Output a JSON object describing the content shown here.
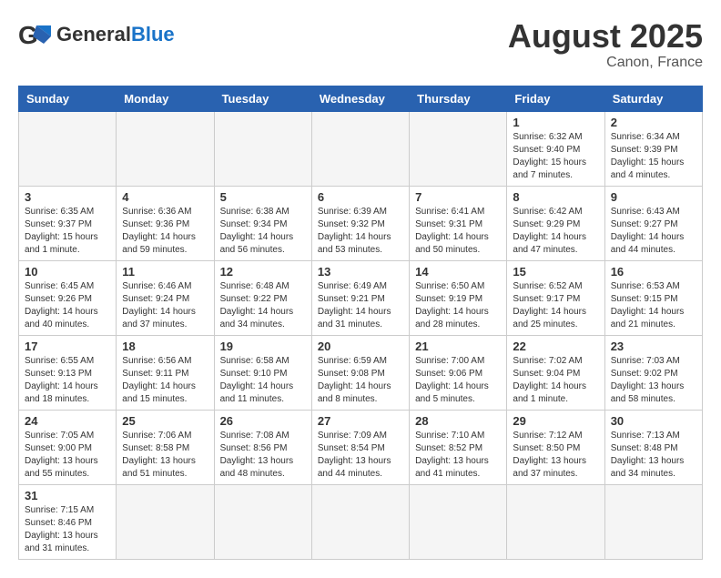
{
  "header": {
    "logo_general": "General",
    "logo_blue": "Blue",
    "month_title": "August 2025",
    "location": "Canon, France"
  },
  "days_of_week": [
    "Sunday",
    "Monday",
    "Tuesday",
    "Wednesday",
    "Thursday",
    "Friday",
    "Saturday"
  ],
  "weeks": [
    [
      {
        "day": "",
        "info": ""
      },
      {
        "day": "",
        "info": ""
      },
      {
        "day": "",
        "info": ""
      },
      {
        "day": "",
        "info": ""
      },
      {
        "day": "",
        "info": ""
      },
      {
        "day": "1",
        "info": "Sunrise: 6:32 AM\nSunset: 9:40 PM\nDaylight: 15 hours and 7 minutes."
      },
      {
        "day": "2",
        "info": "Sunrise: 6:34 AM\nSunset: 9:39 PM\nDaylight: 15 hours and 4 minutes."
      }
    ],
    [
      {
        "day": "3",
        "info": "Sunrise: 6:35 AM\nSunset: 9:37 PM\nDaylight: 15 hours and 1 minute."
      },
      {
        "day": "4",
        "info": "Sunrise: 6:36 AM\nSunset: 9:36 PM\nDaylight: 14 hours and 59 minutes."
      },
      {
        "day": "5",
        "info": "Sunrise: 6:38 AM\nSunset: 9:34 PM\nDaylight: 14 hours and 56 minutes."
      },
      {
        "day": "6",
        "info": "Sunrise: 6:39 AM\nSunset: 9:32 PM\nDaylight: 14 hours and 53 minutes."
      },
      {
        "day": "7",
        "info": "Sunrise: 6:41 AM\nSunset: 9:31 PM\nDaylight: 14 hours and 50 minutes."
      },
      {
        "day": "8",
        "info": "Sunrise: 6:42 AM\nSunset: 9:29 PM\nDaylight: 14 hours and 47 minutes."
      },
      {
        "day": "9",
        "info": "Sunrise: 6:43 AM\nSunset: 9:27 PM\nDaylight: 14 hours and 44 minutes."
      }
    ],
    [
      {
        "day": "10",
        "info": "Sunrise: 6:45 AM\nSunset: 9:26 PM\nDaylight: 14 hours and 40 minutes."
      },
      {
        "day": "11",
        "info": "Sunrise: 6:46 AM\nSunset: 9:24 PM\nDaylight: 14 hours and 37 minutes."
      },
      {
        "day": "12",
        "info": "Sunrise: 6:48 AM\nSunset: 9:22 PM\nDaylight: 14 hours and 34 minutes."
      },
      {
        "day": "13",
        "info": "Sunrise: 6:49 AM\nSunset: 9:21 PM\nDaylight: 14 hours and 31 minutes."
      },
      {
        "day": "14",
        "info": "Sunrise: 6:50 AM\nSunset: 9:19 PM\nDaylight: 14 hours and 28 minutes."
      },
      {
        "day": "15",
        "info": "Sunrise: 6:52 AM\nSunset: 9:17 PM\nDaylight: 14 hours and 25 minutes."
      },
      {
        "day": "16",
        "info": "Sunrise: 6:53 AM\nSunset: 9:15 PM\nDaylight: 14 hours and 21 minutes."
      }
    ],
    [
      {
        "day": "17",
        "info": "Sunrise: 6:55 AM\nSunset: 9:13 PM\nDaylight: 14 hours and 18 minutes."
      },
      {
        "day": "18",
        "info": "Sunrise: 6:56 AM\nSunset: 9:11 PM\nDaylight: 14 hours and 15 minutes."
      },
      {
        "day": "19",
        "info": "Sunrise: 6:58 AM\nSunset: 9:10 PM\nDaylight: 14 hours and 11 minutes."
      },
      {
        "day": "20",
        "info": "Sunrise: 6:59 AM\nSunset: 9:08 PM\nDaylight: 14 hours and 8 minutes."
      },
      {
        "day": "21",
        "info": "Sunrise: 7:00 AM\nSunset: 9:06 PM\nDaylight: 14 hours and 5 minutes."
      },
      {
        "day": "22",
        "info": "Sunrise: 7:02 AM\nSunset: 9:04 PM\nDaylight: 14 hours and 1 minute."
      },
      {
        "day": "23",
        "info": "Sunrise: 7:03 AM\nSunset: 9:02 PM\nDaylight: 13 hours and 58 minutes."
      }
    ],
    [
      {
        "day": "24",
        "info": "Sunrise: 7:05 AM\nSunset: 9:00 PM\nDaylight: 13 hours and 55 minutes."
      },
      {
        "day": "25",
        "info": "Sunrise: 7:06 AM\nSunset: 8:58 PM\nDaylight: 13 hours and 51 minutes."
      },
      {
        "day": "26",
        "info": "Sunrise: 7:08 AM\nSunset: 8:56 PM\nDaylight: 13 hours and 48 minutes."
      },
      {
        "day": "27",
        "info": "Sunrise: 7:09 AM\nSunset: 8:54 PM\nDaylight: 13 hours and 44 minutes."
      },
      {
        "day": "28",
        "info": "Sunrise: 7:10 AM\nSunset: 8:52 PM\nDaylight: 13 hours and 41 minutes."
      },
      {
        "day": "29",
        "info": "Sunrise: 7:12 AM\nSunset: 8:50 PM\nDaylight: 13 hours and 37 minutes."
      },
      {
        "day": "30",
        "info": "Sunrise: 7:13 AM\nSunset: 8:48 PM\nDaylight: 13 hours and 34 minutes."
      }
    ],
    [
      {
        "day": "31",
        "info": "Sunrise: 7:15 AM\nSunset: 8:46 PM\nDaylight: 13 hours and 31 minutes."
      },
      {
        "day": "",
        "info": ""
      },
      {
        "day": "",
        "info": ""
      },
      {
        "day": "",
        "info": ""
      },
      {
        "day": "",
        "info": ""
      },
      {
        "day": "",
        "info": ""
      },
      {
        "day": "",
        "info": ""
      }
    ]
  ]
}
